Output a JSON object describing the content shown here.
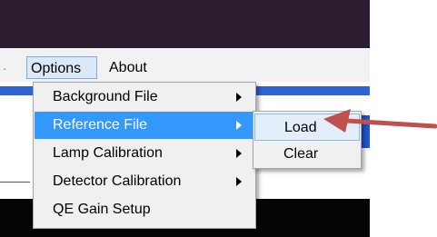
{
  "menubar": {
    "items": [
      {
        "label": "Options",
        "state": "open"
      },
      {
        "label": "About"
      }
    ]
  },
  "options_menu": {
    "items": [
      {
        "label": "Background File",
        "has_submenu": true
      },
      {
        "label": "Reference File",
        "has_submenu": true,
        "highlighted": true
      },
      {
        "label": "Lamp Calibration",
        "has_submenu": true
      },
      {
        "label": "Detector Calibration",
        "has_submenu": true
      },
      {
        "label": "QE Gain Setup",
        "has_submenu": false
      }
    ]
  },
  "reference_submenu": {
    "items": [
      {
        "label": "Load",
        "hovered": true
      },
      {
        "label": "Clear"
      }
    ]
  },
  "colors": {
    "highlight": "#3399ff",
    "title_bar": "#2b1c30",
    "annotation_arrow": "#c0504d"
  },
  "annotation": {
    "icon": "red-arrow-icon",
    "points_to": "Load"
  }
}
